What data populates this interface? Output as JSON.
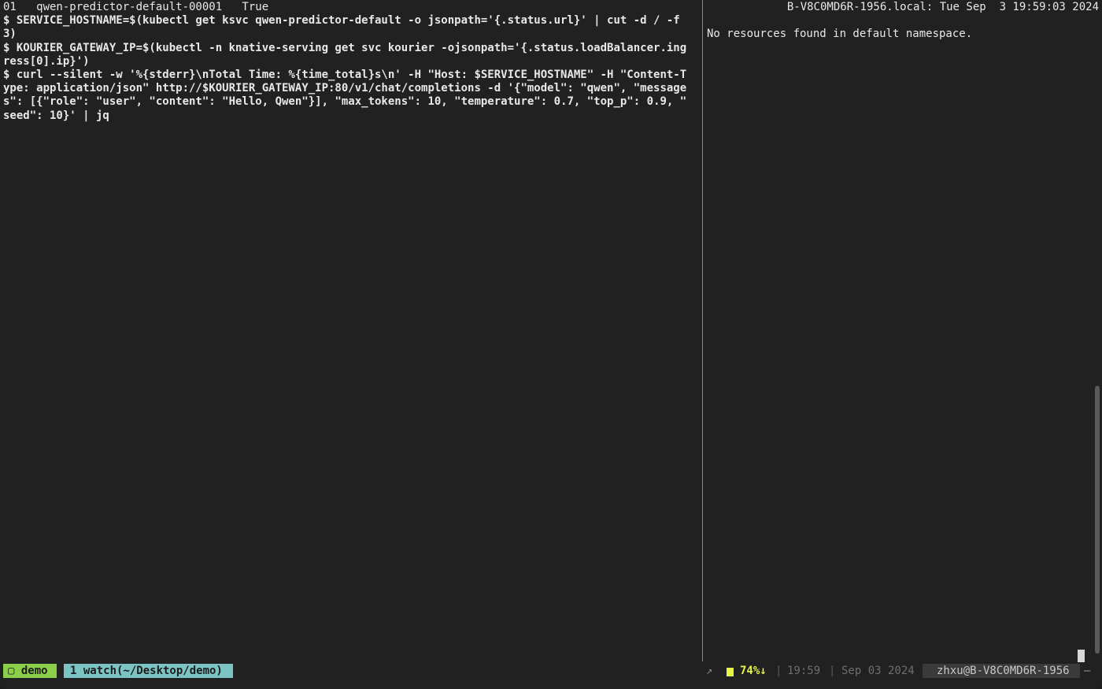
{
  "left_pane": {
    "lines": [
      {
        "text": "01   qwen-predictor-default-00001   True",
        "bold": false
      },
      {
        "text": "$ SERVICE_HOSTNAME=$(kubectl get ksvc qwen-predictor-default -o jsonpath='{.status.url}' | cut -d / -f",
        "bold": true
      },
      {
        "text": "3)",
        "bold": true
      },
      {
        "text": "$ KOURIER_GATEWAY_IP=$(kubectl -n knative-serving get svc kourier -ojsonpath='{.status.loadBalancer.ing",
        "bold": true
      },
      {
        "text": "ress[0].ip}')",
        "bold": true
      },
      {
        "text": "$ curl --silent -w '%{stderr}\\nTotal Time: %{time_total}s\\n' -H \"Host: $SERVICE_HOSTNAME\" -H \"Content-T",
        "bold": true
      },
      {
        "text": "ype: application/json\" http://$KOURIER_GATEWAY_IP:80/v1/chat/completions -d '{\"model\": \"qwen\", \"message",
        "bold": true
      },
      {
        "text": "s\": [{\"role\": \"user\", \"content\": \"Hello, Qwen\"}], \"max_tokens\": 10, \"temperature\": 0.7, \"top_p\": 0.9, \"",
        "bold": true
      },
      {
        "text": "seed\": 10}' | jq",
        "bold": true
      }
    ]
  },
  "right_pane": {
    "header": "B-V8C0MD6R-1956.local: Tue Sep  3 19:59:03 2024",
    "message": "No resources found in default namespace."
  },
  "status_bar": {
    "session": "▢ demo",
    "window": "1 watch(~/Desktop/demo)",
    "arrow": "↗",
    "battery": "74%↓",
    "separator": "|",
    "time": "19:59",
    "date": "Sep 03 2024",
    "host": "zhxu@B-V8C0MD6R-1956",
    "dash": "–"
  },
  "colors": {
    "background": "#212121",
    "session_green": "#8ccf4a",
    "window_teal": "#7cc4c4",
    "battery_yellow": "#e5f545"
  }
}
